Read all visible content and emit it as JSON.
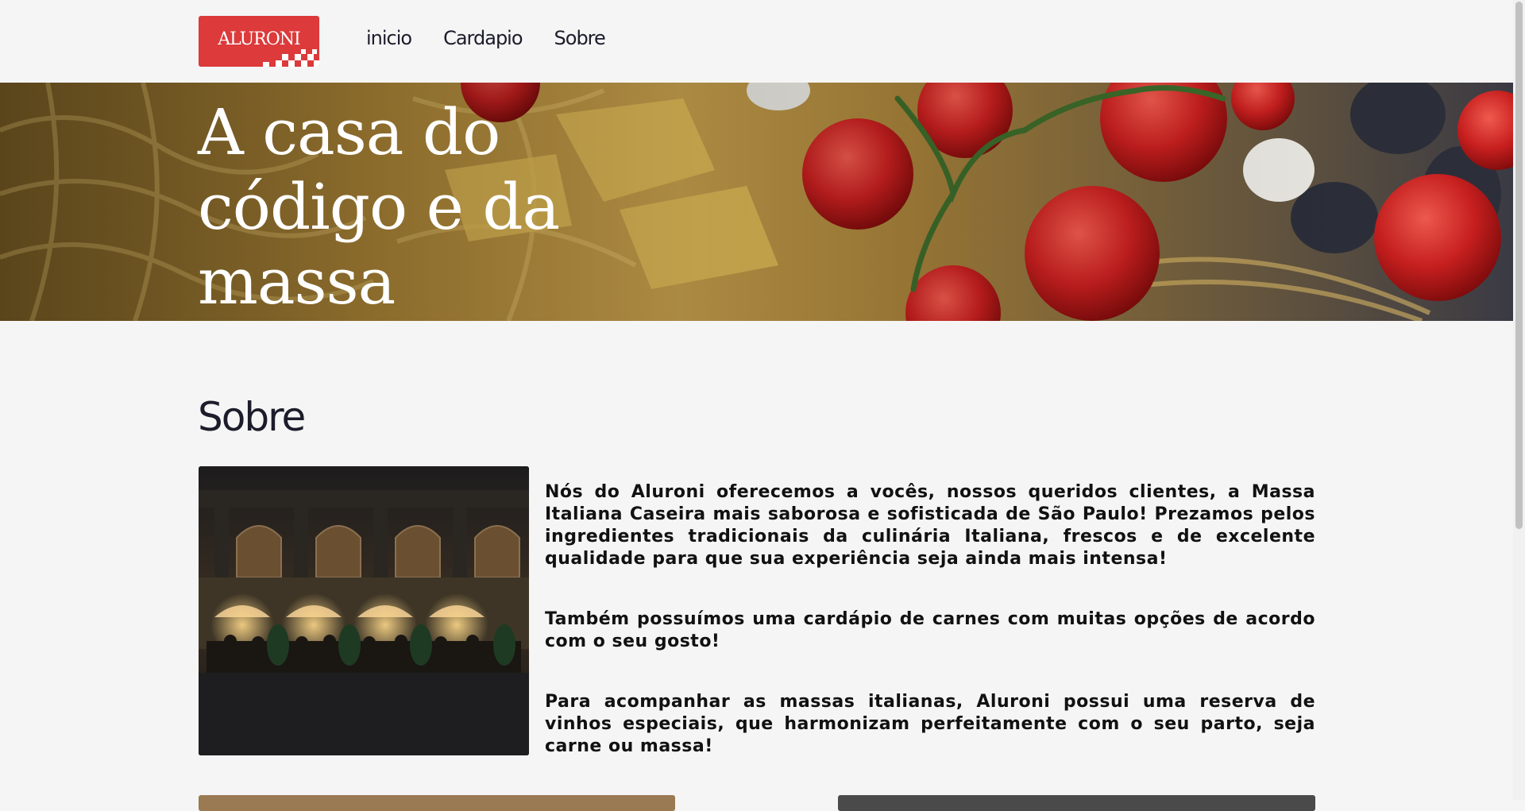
{
  "header": {
    "logo_text": "ALURONI",
    "nav": [
      {
        "label": "inicio"
      },
      {
        "label": "Cardapio"
      },
      {
        "label": "Sobre"
      }
    ]
  },
  "hero": {
    "title": "A casa do código e da massa"
  },
  "about": {
    "title": "Sobre",
    "paragraphs": [
      "Nós do Aluroni oferecemos a vocês, nossos queridos clientes, a Massa Italiana Caseira mais saborosa e sofisticada de São Paulo! Prezamos pelos ingredientes tradicionais da culinária Italiana, frescos e de excelente qualidade para que sua experiência seja ainda mais intensa!",
      "Também possuímos uma cardápio de carnes com muitas opções de acordo com o seu gosto!",
      "Para acompanhar as massas italianas, Aluroni possui uma reserva de vinhos especiais, que harmonizam perfeitamente com o seu parto, seja carne ou massa!"
    ]
  },
  "colors": {
    "brand_red": "#dc3a3b",
    "background": "#f5f5f5",
    "text_dark": "#1c1c2b"
  }
}
